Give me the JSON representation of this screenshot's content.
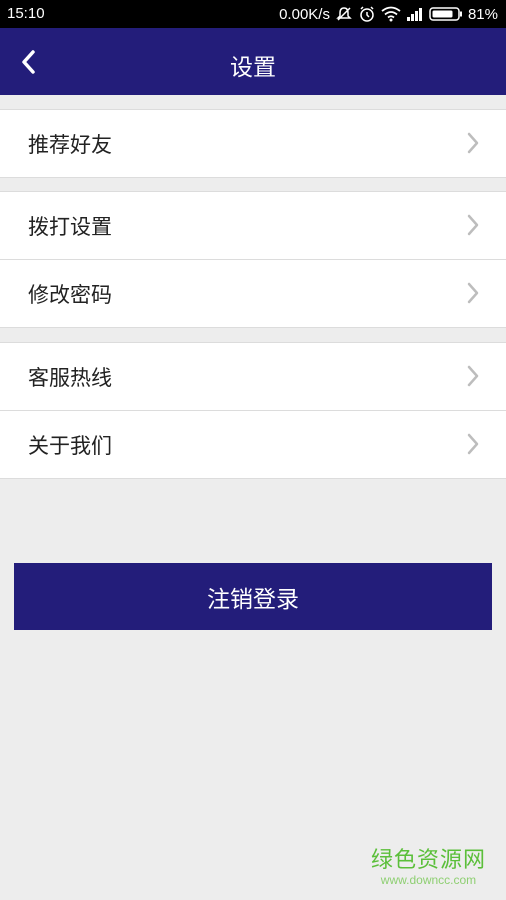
{
  "status_bar": {
    "time": "15:10",
    "net_speed": "0.00K/s",
    "battery": "81%",
    "icons": [
      "silent-icon",
      "alarm-icon",
      "wifi-icon",
      "signal-icon",
      "battery-icon"
    ]
  },
  "header": {
    "title": "设置",
    "back_icon": "chevron-left-icon"
  },
  "groups": [
    {
      "items": [
        {
          "label": "推荐好友"
        }
      ]
    },
    {
      "items": [
        {
          "label": "拨打设置"
        },
        {
          "label": "修改密码"
        }
      ]
    },
    {
      "items": [
        {
          "label": "客服热线"
        },
        {
          "label": "关于我们"
        }
      ]
    }
  ],
  "logout_label": "注销登录",
  "watermark": {
    "name": "绿色资源网",
    "url": "www.downcc.com"
  },
  "colors": {
    "primary": "#231d7a",
    "background": "#ededed",
    "chevron": "#bdbdbd",
    "watermark": "#5bbf3a"
  }
}
